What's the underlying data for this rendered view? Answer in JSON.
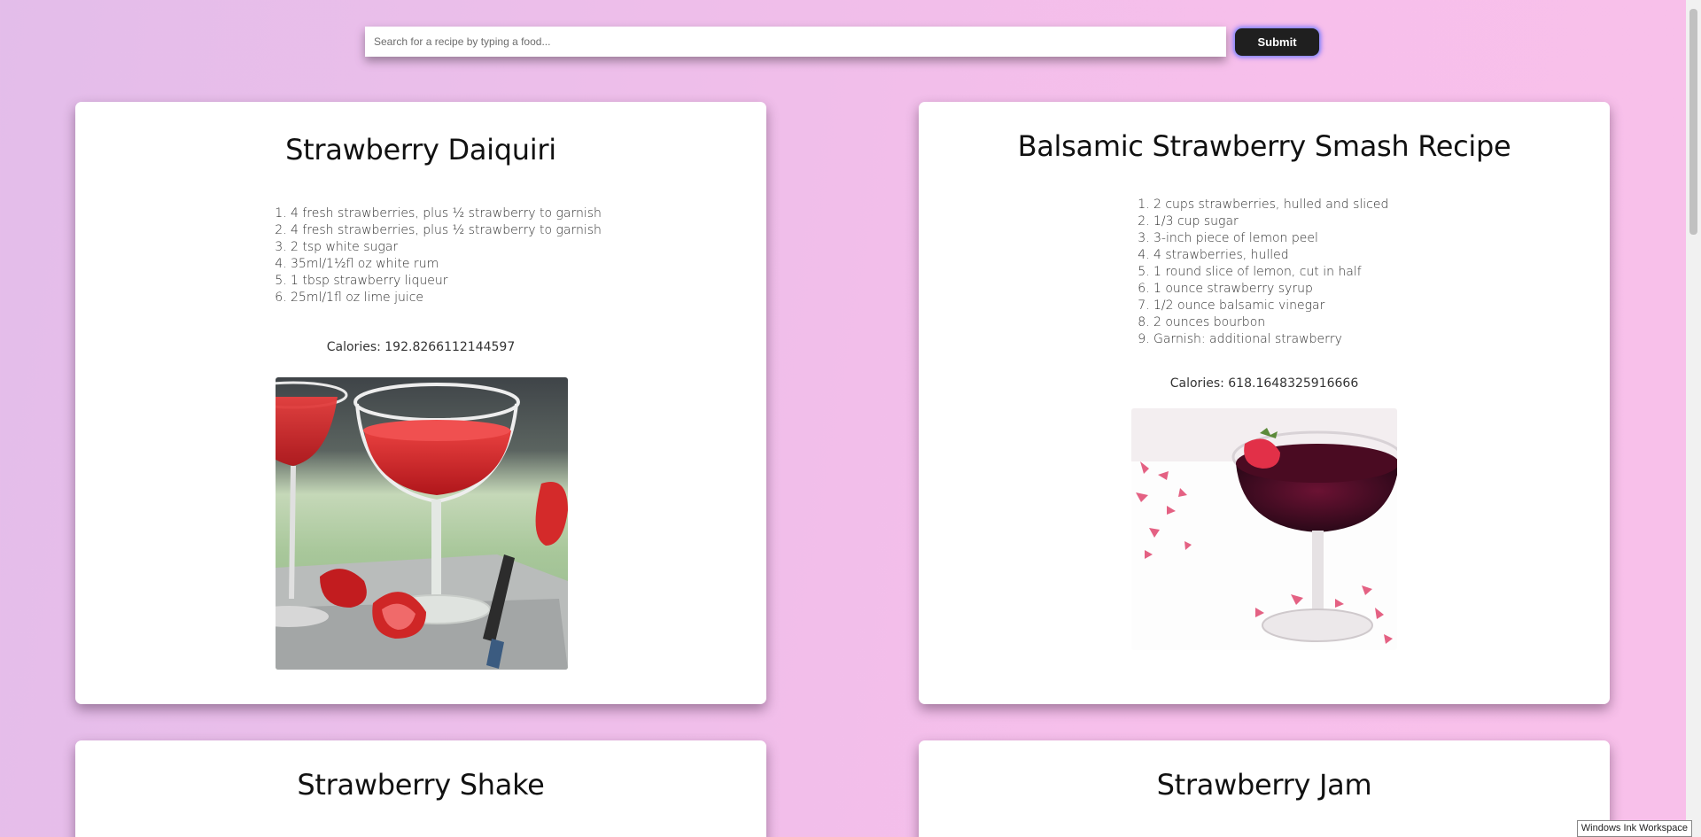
{
  "search": {
    "placeholder": "Search for a recipe by typing a food...",
    "value": "",
    "submit_label": "Submit"
  },
  "recipes": [
    {
      "title": "Strawberry Daiquiri",
      "ingredients": [
        "4 fresh strawberries, plus ½ strawberry to garnish",
        "4 fresh strawberries, plus ½ strawberry to garnish",
        "2 tsp white sugar",
        "35ml/1½fl oz white rum",
        "1 tbsp strawberry liqueur",
        "25ml/1fl oz lime juice"
      ],
      "calories": "Calories: 192.8266112144597"
    },
    {
      "title": "Balsamic Strawberry Smash Recipe",
      "ingredients": [
        "2 cups strawberries, hulled and sliced",
        "1/3 cup sugar",
        "3-inch piece of lemon peel",
        "4 strawberries, hulled",
        "1 round slice of lemon, cut in half",
        "1 ounce strawberry syrup",
        "1/2 ounce balsamic vinegar",
        "2 ounces bourbon",
        "Garnish: additional strawberry"
      ],
      "calories": "Calories: 618.1648325916666"
    },
    {
      "title": "Strawberry Shake"
    },
    {
      "title": "Strawberry Jam"
    }
  ],
  "taskbar_tooltip": "Windows Ink Workspace",
  "colors": {
    "background_left": "#e3bdea",
    "background_right": "#f8c0ea",
    "card": "#ffffff",
    "submit_button": "#1f1f1f"
  }
}
